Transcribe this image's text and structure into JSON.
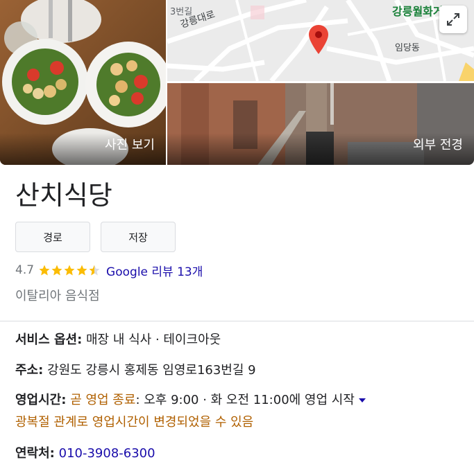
{
  "media": {
    "photo_label": "사진 보기",
    "street_label": "외부 전경",
    "map_labels": {
      "road_top": "3번길",
      "road_main": "강릉대로",
      "area_green": "강릉월화거리",
      "district": "임당동"
    }
  },
  "place": {
    "name": "산치식당",
    "route_label": "경로",
    "save_label": "저장",
    "rating": "4.7",
    "stars": 4.5,
    "reviews_label": "Google 리뷰 13개",
    "category": "이탈리아 음식점"
  },
  "info": {
    "service_label": "서비스 옵션:",
    "service_value": "매장 내 식사 · 테이크아웃",
    "address_label": "주소:",
    "address_value": "강원도 강릉시 홍제동 임영로163번길 9",
    "hours_label": "영업시간:",
    "hours_status": "곧 영업 종료",
    "hours_detail": ": 오후 9:00 · 화 오전 11:00에 영업 시작",
    "hours_note": "광복절 관계로 영업시간이 변경되었을 수 있음",
    "phone_label": "연락처:",
    "phone_value": "010-3908-6300"
  },
  "colors": {
    "link": "#1a0dab",
    "star": "#fbbc04",
    "warning": "#b06000",
    "map_pin": "#ea4335",
    "map_green": "#188038"
  }
}
